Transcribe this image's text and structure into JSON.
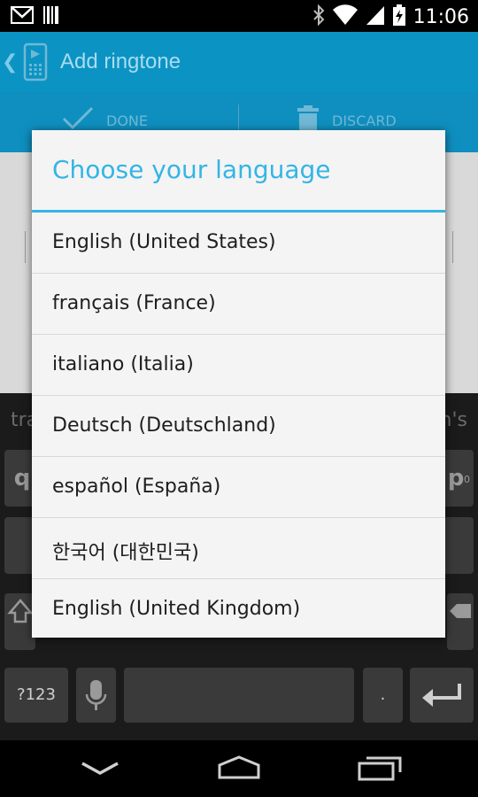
{
  "status_bar": {
    "time": "11:06",
    "icons": [
      "gmail-icon",
      "barcode-icon",
      "bluetooth-icon",
      "wifi-icon",
      "signal-icon",
      "battery-icon"
    ]
  },
  "app": {
    "title": "Add ringtone",
    "done_label": "DONE",
    "discard_label": "DISCARD",
    "accent_color": "#0b93c4"
  },
  "keyboard": {
    "suggestion_left": "tra",
    "suggestion_right": "n's",
    "key_q": "q",
    "key_p": "p",
    "key_p_hint": "0",
    "key_symbols": "?123",
    "key_period": "."
  },
  "dialog": {
    "title": "Choose your language",
    "title_color": "#33b5e5",
    "languages": [
      "English (United States)",
      "français (France)",
      "italiano (Italia)",
      "Deutsch (Deutschland)",
      "español (España)",
      "한국어 (대한민국)",
      "English (United Kingdom)"
    ]
  }
}
